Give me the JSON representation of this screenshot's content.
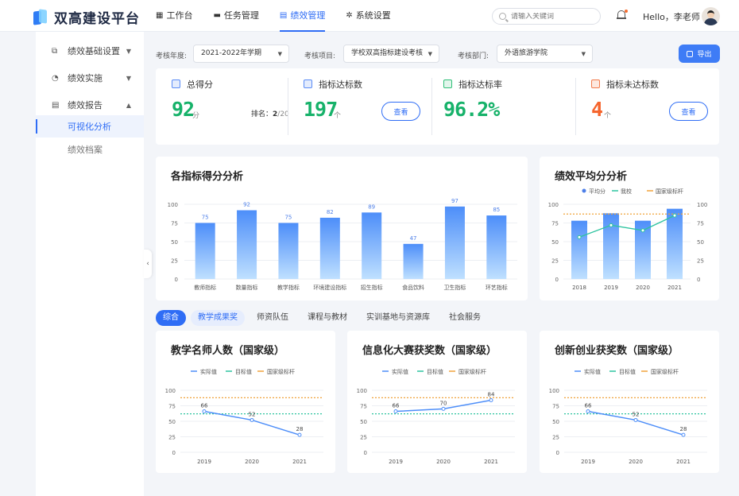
{
  "app": {
    "title": "双高建设平台"
  },
  "nav": [
    {
      "label": "工作台",
      "icon": "grid-icon"
    },
    {
      "label": "任务管理",
      "icon": "briefcase-icon"
    },
    {
      "label": "绩效管理",
      "icon": "chart-icon",
      "active": true
    },
    {
      "label": "系统设置",
      "icon": "gear-icon"
    }
  ],
  "search": {
    "placeholder": "请输入关键词"
  },
  "user": {
    "greeting": "Hello，李老师"
  },
  "sidebar": {
    "items": [
      {
        "label": "绩效基础设置",
        "icon": "settings-doc-icon",
        "expandable": true
      },
      {
        "label": "绩效实施",
        "icon": "pie-icon",
        "expandable": true
      },
      {
        "label": "绩效报告",
        "icon": "report-icon",
        "expandable": true,
        "expanded": true
      }
    ],
    "sub_items": [
      {
        "label": "可视化分析",
        "active": true
      },
      {
        "label": "绩效档案",
        "active": false
      }
    ]
  },
  "filters": {
    "year_label": "考核年度:",
    "year_value": "2021-2022年学期",
    "project_label": "考核项目:",
    "project_value": "学校双高指标建设考核",
    "dept_label": "考核部门:",
    "dept_value": "外语旅游学院",
    "export_label": "导出"
  },
  "stats": {
    "total": {
      "title": "总得分",
      "value": "92",
      "unit": "分",
      "rank_label": "排名：",
      "rank_value": "2",
      "rank_total": "/20"
    },
    "reached": {
      "title": "指标达标数",
      "value": "197",
      "unit": "个",
      "button": "查看"
    },
    "rate": {
      "title": "指标达标率",
      "value": "96.2%"
    },
    "unreached": {
      "title": "指标未达标数",
      "value": "4",
      "unit": "个",
      "button": "查看"
    }
  },
  "colors": {
    "primary": "#2f6df5",
    "green": "#17b26a",
    "orange": "#f5652d",
    "benchmark": "#f0a23a",
    "target": "#2ec4a0",
    "bar_top": "#4d8ef9",
    "bar_bottom": "#bfe0ff"
  },
  "chart_data": [
    {
      "type": "bar",
      "title": "各指标得分分析",
      "categories": [
        "教师指标",
        "数量指标",
        "教学指标",
        "环境建设指标",
        "招生指标",
        "食品饮料",
        "卫生指标",
        "环艺指标"
      ],
      "values": [
        75,
        92,
        75,
        82,
        89,
        47,
        97,
        85
      ],
      "ylim": [
        0,
        100
      ],
      "yticks": [
        0,
        25,
        50,
        75,
        100
      ],
      "grid": true
    },
    {
      "type": "bar",
      "title": "绩效平均分分析",
      "categories": [
        "2018",
        "2019",
        "2020",
        "2021"
      ],
      "series": [
        {
          "name": "平均分",
          "kind": "bar",
          "values": [
            78,
            88,
            78,
            94
          ]
        },
        {
          "name": "我校",
          "kind": "line",
          "values": [
            56,
            72,
            65,
            85
          ]
        },
        {
          "name": "国家级标杆",
          "kind": "dashed",
          "values": [
            87,
            87,
            87,
            87
          ]
        }
      ],
      "ylim": [
        0,
        100
      ],
      "yticks": [
        0,
        25,
        50,
        75,
        100
      ],
      "legend": "top-center"
    },
    {
      "type": "line",
      "title": "教学名师人数（国家级）",
      "categories": [
        "2019",
        "2020",
        "2021"
      ],
      "series": [
        {
          "name": "实际值",
          "values": [
            66,
            52,
            28
          ]
        },
        {
          "name": "目标值",
          "values": [
            62,
            62,
            62
          ]
        },
        {
          "name": "国家级标杆",
          "values": [
            88,
            88,
            88
          ]
        }
      ],
      "ylim": [
        0,
        100
      ],
      "yticks": [
        0,
        25,
        50,
        75,
        100
      ],
      "legend": "top-center"
    },
    {
      "type": "line",
      "title": "信息化大赛获奖数（国家级）",
      "categories": [
        "2019",
        "2020",
        "2021"
      ],
      "series": [
        {
          "name": "实际值",
          "values": [
            66,
            70,
            84
          ]
        },
        {
          "name": "目标值",
          "values": [
            62,
            62,
            62
          ]
        },
        {
          "name": "国家级标杆",
          "values": [
            88,
            88,
            88
          ]
        }
      ],
      "ylim": [
        0,
        100
      ],
      "yticks": [
        0,
        25,
        50,
        75,
        100
      ],
      "legend": "top-center"
    },
    {
      "type": "line",
      "title": "创新创业获奖数（国家级）",
      "categories": [
        "2019",
        "2020",
        "2021"
      ],
      "series": [
        {
          "name": "实际值",
          "values": [
            66,
            52,
            28
          ]
        },
        {
          "name": "目标值",
          "values": [
            62,
            62,
            62
          ]
        },
        {
          "name": "国家级标杆",
          "values": [
            88,
            88,
            88
          ]
        }
      ],
      "ylim": [
        0,
        100
      ],
      "yticks": [
        0,
        25,
        50,
        75,
        100
      ],
      "legend": "top-center"
    }
  ],
  "tabs": [
    {
      "label": "综合",
      "state": "active"
    },
    {
      "label": "教学成果奖",
      "state": "light"
    },
    {
      "label": "师资队伍",
      "state": ""
    },
    {
      "label": "课程与教材",
      "state": ""
    },
    {
      "label": "实训基地与资源库",
      "state": ""
    },
    {
      "label": "社会服务",
      "state": ""
    }
  ]
}
